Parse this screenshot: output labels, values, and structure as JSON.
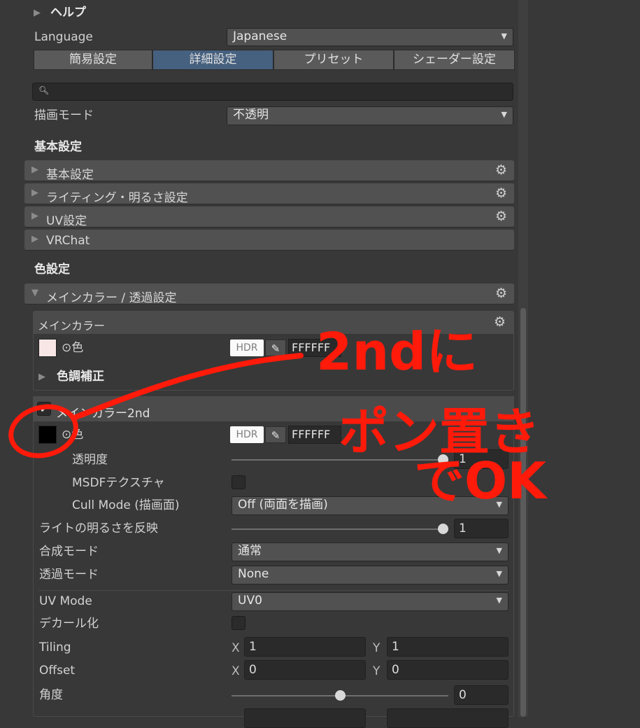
{
  "header": {
    "help_label": "ヘルプ"
  },
  "language": {
    "label": "Language",
    "value": "Japanese"
  },
  "tabs": [
    {
      "label": "簡易設定",
      "active": false
    },
    {
      "label": "詳細設定",
      "active": true
    },
    {
      "label": "プリセット",
      "active": false
    },
    {
      "label": "シェーダー設定",
      "active": false
    }
  ],
  "search": {
    "value": ""
  },
  "render_mode": {
    "label": "描画モード",
    "value": "不透明"
  },
  "basic_section": {
    "title": "基本設定",
    "foldouts": [
      {
        "label": "基本設定"
      },
      {
        "label": "ライティング・明るさ設定"
      },
      {
        "label": "UV設定"
      },
      {
        "label": "VRChat"
      }
    ]
  },
  "color_section": {
    "title": "色設定",
    "main_foldout": "メインカラー / 透過設定",
    "main_color": {
      "box_title": "メインカラー",
      "color_label": "⊙色",
      "hdr": "HDR",
      "hex": "FFFFFF",
      "swatch_color": "#f8e6e6",
      "tone_label": "色調補正"
    },
    "main_color_2nd": {
      "title": "メインカラー2nd",
      "color_label": "⊙色",
      "hdr": "HDR",
      "hex": "FFFFFF",
      "swatch_color": "#000000",
      "opacity_label": "透明度",
      "opacity_value": "1",
      "msdf_label": "MSDFテクスチャ",
      "cull_label": "Cull Mode (描画面)",
      "cull_value": "Off (両面を描画)",
      "light_label": "ライトの明るさを反映",
      "light_value": "1",
      "blend_label": "合成モード",
      "blend_value": "通常",
      "alpha_label": "透過モード",
      "alpha_value": "None",
      "uvmode_label": "UV Mode",
      "uvmode_value": "UV0",
      "decal_label": "デカール化",
      "tiling_label": "Tiling",
      "tiling_x": "1",
      "tiling_y": "1",
      "offset_label": "Offset",
      "offset_x": "0",
      "offset_y": "0",
      "angle_label": "角度",
      "angle_value": "0",
      "axis_x": "X",
      "axis_y": "Y"
    }
  },
  "annotation": {
    "line1": "2ndに",
    "line2": "ポン置き",
    "line3": "でOK",
    "color": "#ff1a0a"
  }
}
